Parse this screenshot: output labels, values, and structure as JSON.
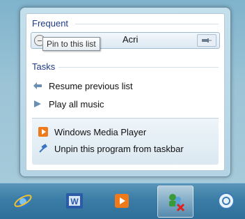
{
  "jumplist": {
    "frequent_header": "Frequent",
    "frequent_item_label": "Acri",
    "tooltip": "Pin to this list",
    "tasks_header": "Tasks",
    "tasks": [
      {
        "label": "Resume previous list",
        "icon": "arrow-left-icon"
      },
      {
        "label": "Play all music",
        "icon": "play-icon"
      }
    ],
    "program_item": {
      "label": "Windows Media Player",
      "icon": "media-player-icon"
    },
    "unpin_item": {
      "label": "Unpin this program from taskbar",
      "icon": "unpin-icon"
    }
  },
  "taskbar": {
    "buttons": [
      {
        "name": "internet-explorer",
        "icon": "ie-icon"
      },
      {
        "name": "word",
        "icon": "word-icon"
      },
      {
        "name": "windows-media-player",
        "icon": "media-player-icon"
      },
      {
        "name": "network",
        "icon": "network-icon"
      },
      {
        "name": "live-messenger",
        "icon": "messenger-icon"
      }
    ]
  },
  "colors": {
    "header": "#1e3a8a",
    "accent_orange": "#f07a1a",
    "taskbar": "#3b7da6"
  }
}
